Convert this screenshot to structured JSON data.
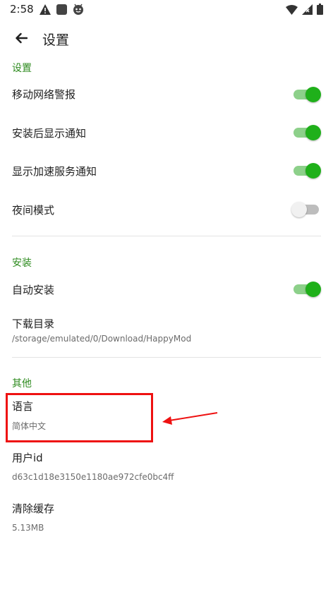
{
  "status_bar": {
    "time": "2:58"
  },
  "toolbar": {
    "title": "设置"
  },
  "sections": {
    "settings": {
      "header": "设置",
      "mobile_alert": {
        "label": "移动网络警报",
        "enabled": true
      },
      "install_notify": {
        "label": "安装后显示通知",
        "enabled": true
      },
      "speed_notify": {
        "label": "显示加速服务通知",
        "enabled": true
      },
      "night_mode": {
        "label": "夜间模式",
        "enabled": false
      }
    },
    "install": {
      "header": "安装",
      "auto_install": {
        "label": "自动安装",
        "enabled": true
      },
      "download_dir": {
        "label": "下载目录",
        "value": "/storage/emulated/0/Download/HappyMod"
      }
    },
    "other": {
      "header": "其他",
      "language": {
        "label": "语言",
        "value": "简体中文"
      },
      "user_id": {
        "label": "用户id",
        "value": "d63c1d18e3150e1180ae972cfe0bc4ff"
      },
      "clear_cache": {
        "label": "清除缓存",
        "value": "5.13MB"
      }
    }
  },
  "colors": {
    "accent": "#2e8b1f",
    "toggle_on": "#1fb01a",
    "annotation": "#ee1111"
  },
  "icons": {
    "back": "arrow-left-icon",
    "warning": "warning-icon",
    "square": "app-square-icon",
    "android": "android-face-icon",
    "wifi": "wifi-icon",
    "signal": "signal-icon",
    "battery": "battery-icon"
  }
}
